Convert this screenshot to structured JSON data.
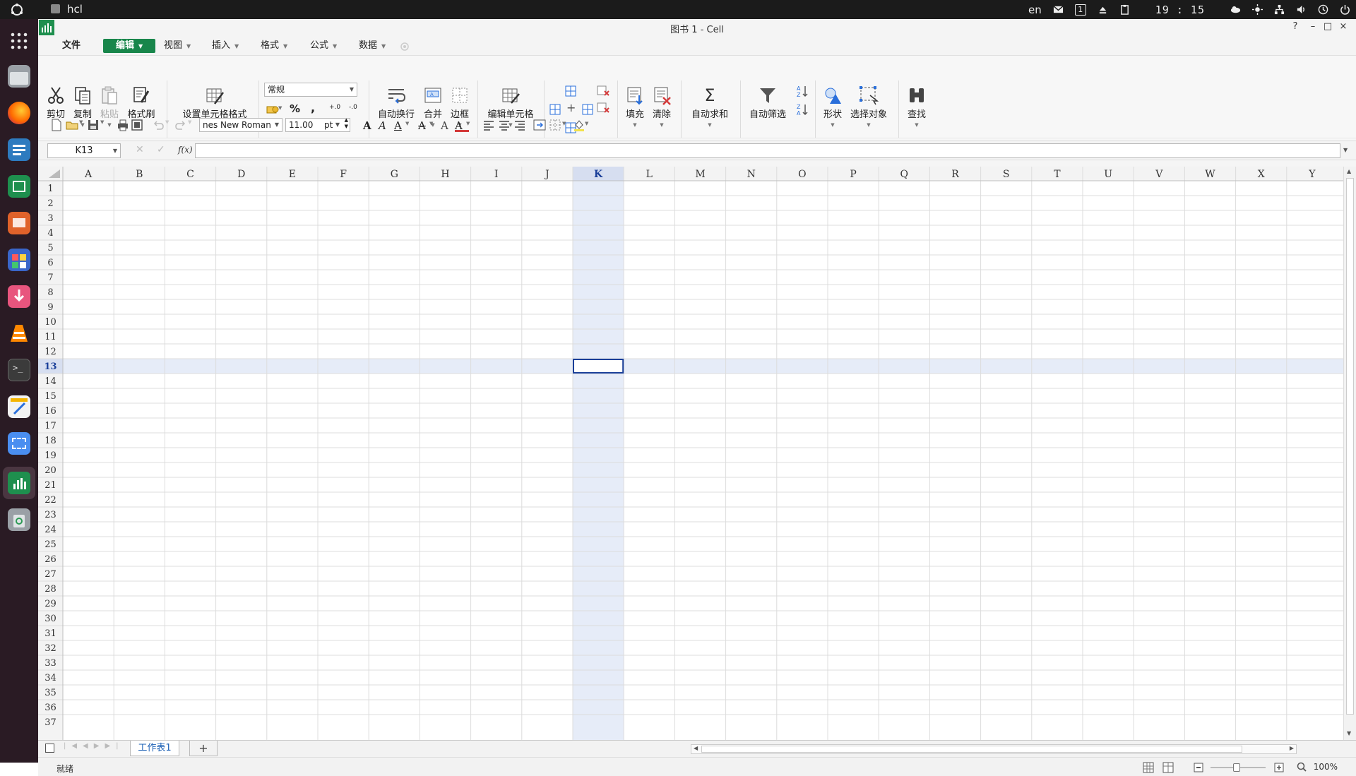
{
  "system_bar": {
    "app_name": "hcl",
    "language": "en",
    "workspace": "1",
    "clock": "19 : 15"
  },
  "window": {
    "title": "图书 1 - Cell",
    "help": "?",
    "minimize": "–",
    "maximize": "□",
    "close": "×"
  },
  "menu": {
    "file": "文件",
    "edit": "编辑",
    "view": "视图",
    "insert": "插入",
    "format": "格式",
    "formula": "公式",
    "data": "数据"
  },
  "ribbon": {
    "cut": "剪切",
    "copy": "复制",
    "paste": "粘贴",
    "format_painter": "格式刷",
    "cell_format": "设置单元格格式",
    "number_format": "常规",
    "percent": "%",
    "comma": ",",
    "inc_decimal": "+.0",
    "dec_decimal": "-.0",
    "wrap_text": "自动换行",
    "merge": "合并",
    "border": "边框",
    "edit_cell": "编辑单元格",
    "fill": "填充",
    "clear": "清除",
    "autosum_symbol": "Σ",
    "autosum": "自动求和",
    "autofilter": "自动筛选",
    "shape": "形状",
    "select_object": "选择对象",
    "find": "查找"
  },
  "toolbar": {
    "font_name": "nes New Roman",
    "font_size": "11.00",
    "font_unit": "pt"
  },
  "formula_bar": {
    "name_box": "K13",
    "fx": "f(x)",
    "formula": ""
  },
  "grid": {
    "columns": [
      "A",
      "B",
      "C",
      "D",
      "E",
      "F",
      "G",
      "H",
      "I",
      "J",
      "K",
      "L",
      "M",
      "N",
      "O",
      "P",
      "Q",
      "R",
      "S",
      "T",
      "U",
      "V",
      "W",
      "X",
      "Y"
    ],
    "rows": [
      "1",
      "2",
      "3",
      "4",
      "5",
      "6",
      "7",
      "8",
      "9",
      "10",
      "11",
      "12",
      "13",
      "14",
      "15",
      "16",
      "17",
      "18",
      "19",
      "20",
      "21",
      "22",
      "23",
      "24",
      "25",
      "26",
      "27",
      "28",
      "29",
      "30",
      "31",
      "32",
      "33",
      "34",
      "35",
      "36",
      "37"
    ],
    "active_column": "K",
    "active_row": "13",
    "colors": {
      "highlight": "#e6ecf8",
      "selection_border": "#1a3f99",
      "header_bg": "#f3f3f3",
      "gridline": "#dcdcdc",
      "accent": "#18864b"
    }
  },
  "sheets": {
    "tabs": [
      "工作表1"
    ],
    "add": "+"
  },
  "status": {
    "text": "就绪",
    "zoom": "100%"
  }
}
